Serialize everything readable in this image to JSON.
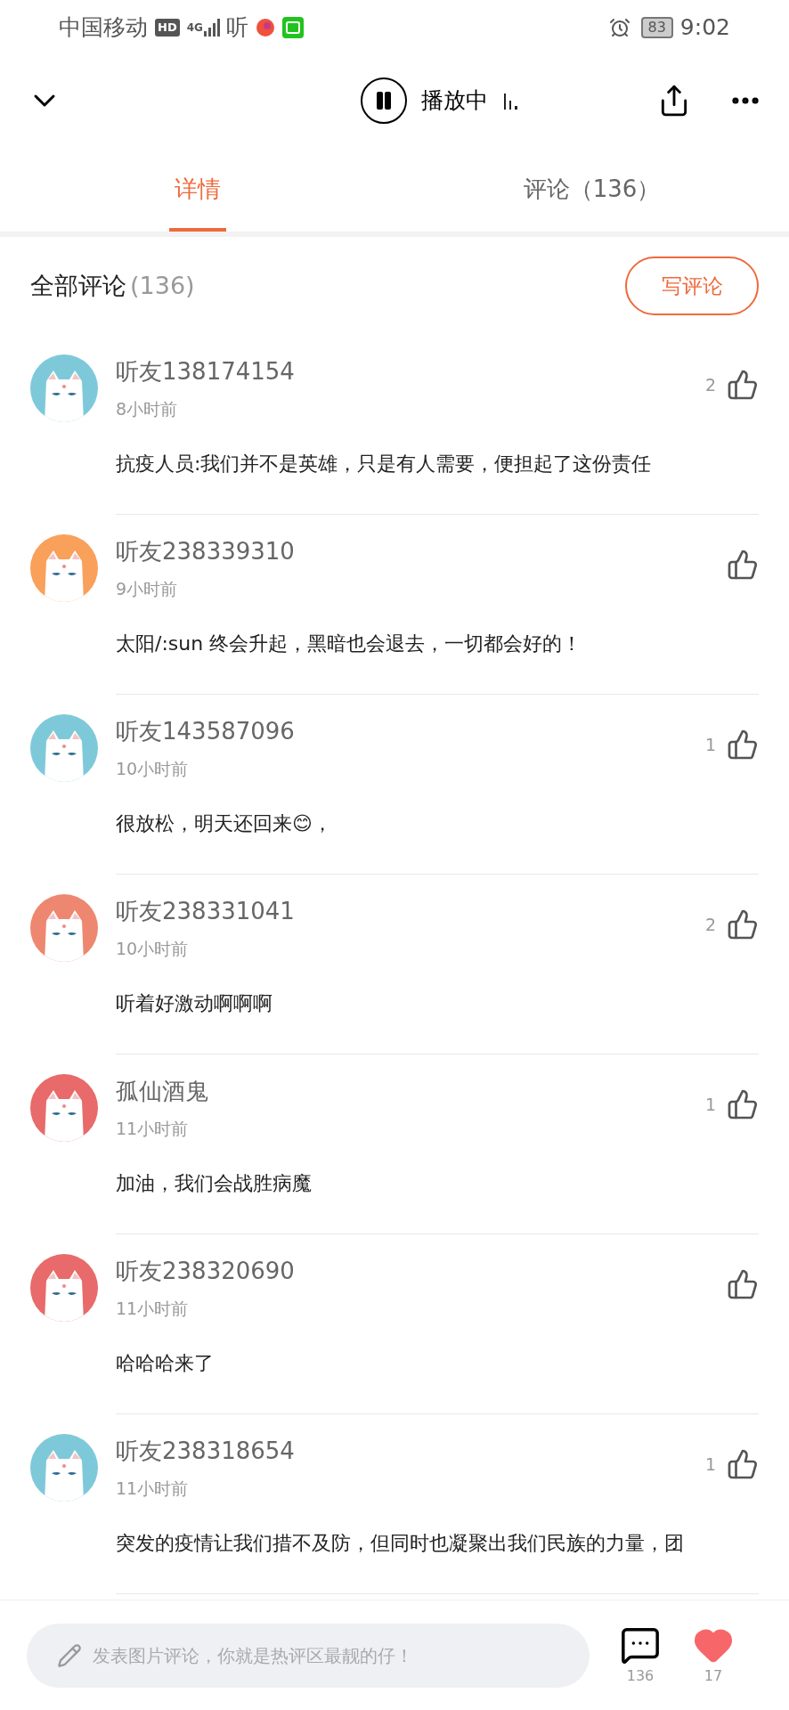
{
  "status_bar": {
    "carrier": "中国移动",
    "hd": "HD",
    "network": "4G",
    "app_glyph": "听",
    "battery": "83",
    "time": "9:02"
  },
  "header": {
    "playing": true,
    "status": "播放中"
  },
  "tabs": [
    {
      "label": "详情",
      "selected": true
    },
    {
      "label": "评论（136）",
      "selected": false
    }
  ],
  "section": {
    "title": "全部评论",
    "count": "(136)",
    "write_button": "写评论"
  },
  "comments": [
    {
      "user": "听友138174154",
      "time": "8小时前",
      "text": "抗疫人员:我们并不是英雄，只是有人需要，便担起了这份责任",
      "likes": "2",
      "color": "#7ec9d9"
    },
    {
      "user": "听友238339310",
      "time": "9小时前",
      "text": "太阳/:sun 终会升起，黑暗也会退去，一切都会好的！",
      "color": "#f9a05b"
    },
    {
      "user": "听友143587096",
      "time": "10小时前",
      "text": "很放松，明天还回来😊，",
      "likes": "1",
      "color": "#7ec9d9"
    },
    {
      "user": "听友238331041",
      "time": "10小时前",
      "text": "听着好激动啊啊啊",
      "likes": "2",
      "color": "#ee8770"
    },
    {
      "user": "孤仙酒鬼",
      "time": "11小时前",
      "text": "加油，我们会战胜病魔",
      "likes": "1",
      "color": "#e86a6a"
    },
    {
      "user": "听友238320690",
      "time": "11小时前",
      "text": "哈哈哈来了",
      "color": "#e86a6a"
    },
    {
      "user": "听友238318654",
      "time": "11小时前",
      "text": "突发的疫情让我们措不及防，但同时也凝聚出我们民族的力量，团",
      "likes": "1",
      "color": "#7ec9d9"
    }
  ],
  "bottom_bar": {
    "placeholder": "发表图片评论，你就是热评区最靓的仔！",
    "comment_count": "136",
    "like_count": "17",
    "liked": true
  }
}
